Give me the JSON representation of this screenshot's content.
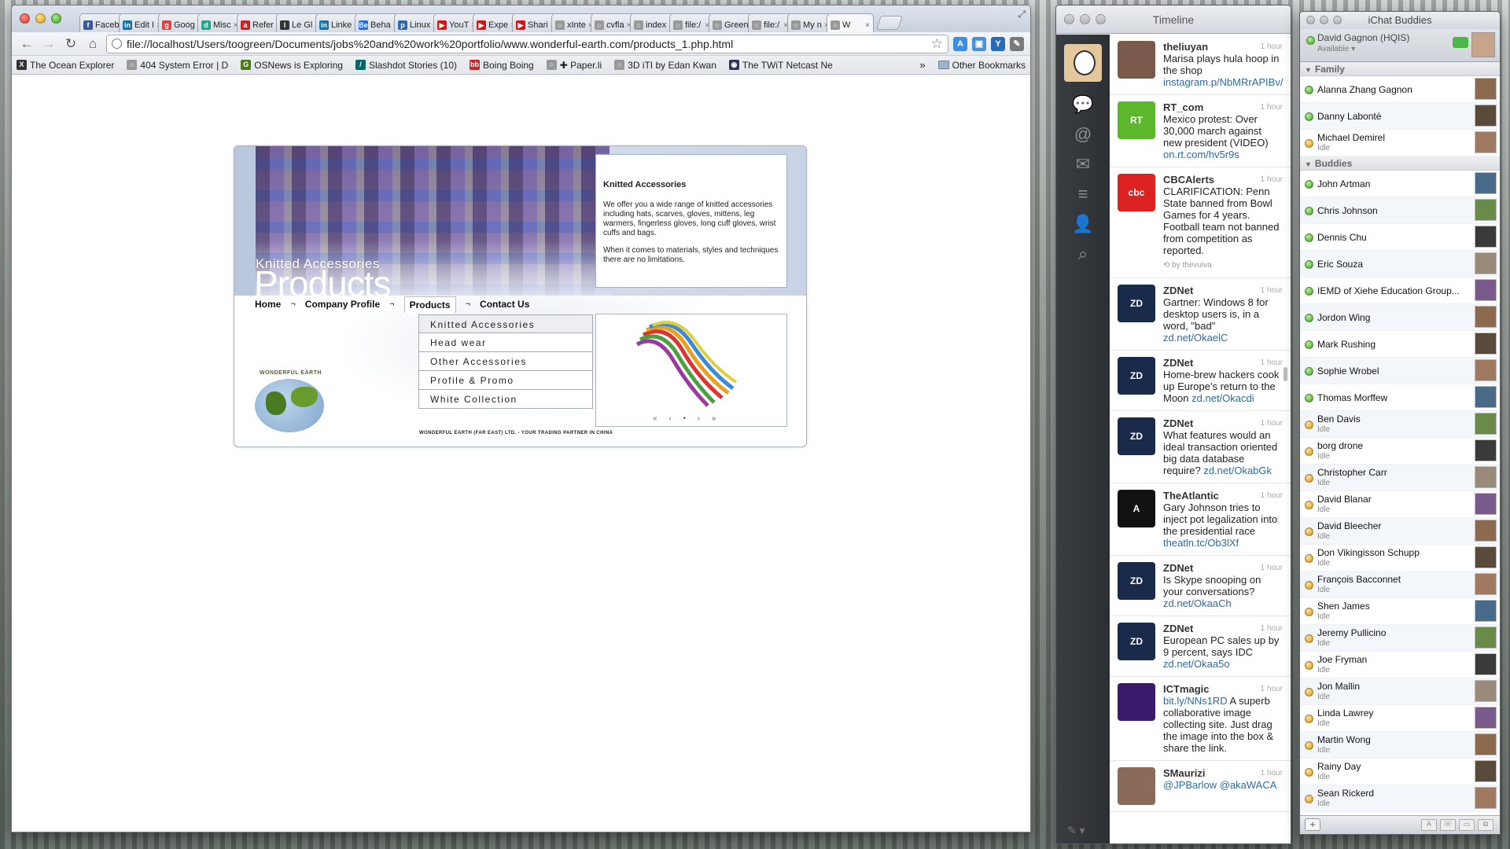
{
  "browser": {
    "tabs": [
      {
        "label": "Faceb",
        "icon": "f",
        "color": "#3b5998"
      },
      {
        "label": "Edit I",
        "icon": "in",
        "color": "#0e76a8"
      },
      {
        "label": "Goog",
        "icon": "g",
        "color": "#d44"
      },
      {
        "label": "Misc",
        "icon": "d",
        "color": "#2a8"
      },
      {
        "label": "Refer",
        "icon": "a",
        "color": "#c22"
      },
      {
        "label": "Le Gl",
        "icon": "l",
        "color": "#333"
      },
      {
        "label": "Linke",
        "icon": "in",
        "color": "#0e76a8"
      },
      {
        "label": "Beha",
        "icon": "Be",
        "color": "#1769ff"
      },
      {
        "label": "Linux",
        "icon": "p",
        "color": "#2a6ab0"
      },
      {
        "label": "YouT",
        "icon": "▶",
        "color": "#d11"
      },
      {
        "label": "Expe",
        "icon": "▶",
        "color": "#d11"
      },
      {
        "label": "Shari",
        "icon": "▶",
        "color": "#d11"
      },
      {
        "label": "xInte",
        "icon": "○",
        "color": "#999"
      },
      {
        "label": "cvfla",
        "icon": "○",
        "color": "#999"
      },
      {
        "label": "index",
        "icon": "○",
        "color": "#999"
      },
      {
        "label": "file:/",
        "icon": "○",
        "color": "#999"
      },
      {
        "label": "Green",
        "icon": "○",
        "color": "#999"
      },
      {
        "label": "file:/",
        "icon": "○",
        "color": "#999"
      },
      {
        "label": "My n",
        "icon": "○",
        "color": "#999"
      },
      {
        "label": "W",
        "icon": "○",
        "color": "#999",
        "active": true
      }
    ],
    "url": "file://localhost/Users/toogreen/Documents/jobs%20and%20work%20portfolio/www.wonderful-earth.com/products_1.php.html",
    "bookmarks": [
      {
        "label": "The Ocean Explorer",
        "icon": "X",
        "color": "#333"
      },
      {
        "label": "404 System Error | D",
        "icon": "○",
        "color": "#999"
      },
      {
        "label": "OSNews is Exploring",
        "icon": "G",
        "color": "#4a7a1a"
      },
      {
        "label": "Slashdot Stories (10)",
        "icon": "/",
        "color": "#006666"
      },
      {
        "label": "Boing Boing",
        "icon": "bb",
        "color": "#c22"
      },
      {
        "label": "✚ Paper.li",
        "icon": "○",
        "color": "#999"
      },
      {
        "label": "3D iTI by Edan Kwan",
        "icon": "○",
        "color": "#999"
      },
      {
        "label": "The TWiT Netcast Ne",
        "icon": "◉",
        "color": "#335"
      }
    ],
    "bookmarks_overflow": "»",
    "other_bookmarks": "Other Bookmarks"
  },
  "site": {
    "banner_subtitle": "Knitted Accessories",
    "banner_title": "Products",
    "info_heading": "Knitted Accessories",
    "info_p1": "We offer you a wide range of knitted accessories including hats, scarves, gloves, mittens, leg warmers, fingerless gloves, long cuff gloves, wrist cuffs and bags.",
    "info_p2": "When it comes to materials, styles and techniques there are no limitations.",
    "nav": [
      "Home",
      "Company Profile",
      "Products",
      "Contact Us"
    ],
    "nav_sep": "¬",
    "submenu": [
      "Knitted Accessories",
      "Head wear",
      "Other Accessories",
      "Profile & Promo",
      "White Collection"
    ],
    "pager": "« ‹ • › »",
    "logo_text": "WONDERFUL EARTH",
    "footer": "WONDERFUL EARTH (FAR EAST) LTD. - YOUR TRADING PARTNER IN CHINA"
  },
  "twitter": {
    "title": "Timeline",
    "tweets": [
      {
        "user": "theliuyan",
        "time": "1 hour",
        "text": "Marisa plays hula hoop in the shop",
        "link": "instagram.p/NbMRrAPIBv/",
        "color": "#7a5a4a",
        "label": ""
      },
      {
        "user": "RT_com",
        "time": "1 hour",
        "text": "Mexico protest: Over 30,000 march against new president (VIDEO)",
        "link": "on.rt.com/hv5r9s",
        "color": "#5cb82a",
        "label": "RT"
      },
      {
        "user": "CBCAlerts",
        "time": "1 hour",
        "text": "CLARIFICATION: Penn State banned from Bowl Games for 4 years. Football team not banned from competition as reported.",
        "link": "",
        "color": "#d22",
        "label": "cbc",
        "retweet": "by thevuiva"
      },
      {
        "user": "ZDNet",
        "time": "1 hour",
        "text": "Gartner: Windows 8 for desktop users is, in a word, \"bad\"",
        "link": "zd.net/OkaelC",
        "color": "#1a2a4a",
        "label": "ZD"
      },
      {
        "user": "ZDNet",
        "time": "1 hour",
        "text": "Home-brew hackers cook up Europe's return to the Moon",
        "link": "zd.net/Okacdi",
        "color": "#1a2a4a",
        "label": "ZD"
      },
      {
        "user": "ZDNet",
        "time": "1 hour",
        "text": "What features would an ideal transaction oriented big data database require?",
        "link": "zd.net/OkabGk",
        "color": "#1a2a4a",
        "label": "ZD"
      },
      {
        "user": "TheAtlantic",
        "time": "1 hour",
        "text": "Gary Johnson tries to inject pot legalization into the presidential race",
        "link": "theatln.tc/Ob3lXf",
        "color": "#111",
        "label": "A"
      },
      {
        "user": "ZDNet",
        "time": "1 hour",
        "text": "Is Skype snooping on your conversations?",
        "link": "zd.net/OkaaCh",
        "color": "#1a2a4a",
        "label": "ZD"
      },
      {
        "user": "ZDNet",
        "time": "1 hour",
        "text": "European PC sales up by 9 percent, says IDC",
        "link": "zd.net/Okaa5o",
        "color": "#1a2a4a",
        "label": "ZD"
      },
      {
        "user": "ICTmagic",
        "time": "1 hour",
        "text": "A superb collaborative image collecting site. Just drag the image into the box & share the link.",
        "link": "bit.ly/NNs1RD",
        "color": "#3a1a6a",
        "label": "",
        "link_first": true
      },
      {
        "user": "SMaurizi",
        "time": "1 hour",
        "text": "",
        "link": "@JPBarlow @akaWACA",
        "color": "#8a6a5a",
        "label": ""
      }
    ]
  },
  "ichat": {
    "title": "iChat Buddies",
    "me_name": "David Gagnon (HQIS)",
    "me_status": "Available ▾",
    "groups": [
      {
        "name": "Family",
        "buddies": [
          {
            "name": "Alanna Zhang Gagnon",
            "status": "green"
          },
          {
            "name": "Danny Labonté",
            "status": "green"
          },
          {
            "name": "Michael Demirel",
            "status": "amber",
            "sub": "Idle"
          }
        ]
      },
      {
        "name": "Buddies",
        "buddies": [
          {
            "name": "John Artman",
            "status": "green"
          },
          {
            "name": "Chris Johnson",
            "status": "green"
          },
          {
            "name": "Dennis Chu",
            "status": "green"
          },
          {
            "name": "Eric Souza",
            "status": "green"
          },
          {
            "name": "IEMD of Xiehe Education Group...",
            "status": "green"
          },
          {
            "name": "Jordon Wing",
            "status": "green"
          },
          {
            "name": "Mark Rushing",
            "status": "green"
          },
          {
            "name": "Sophie Wrobel",
            "status": "green"
          },
          {
            "name": "Thomas Morffew",
            "status": "green"
          },
          {
            "name": "Ben Davis",
            "status": "amber",
            "sub": "Idle"
          },
          {
            "name": "borg drone",
            "status": "amber",
            "sub": "Idle"
          },
          {
            "name": "Christopher Carr",
            "status": "amber",
            "sub": "Idle"
          },
          {
            "name": "David Blanar",
            "status": "amber",
            "sub": "Idle"
          },
          {
            "name": "David Bleecher",
            "status": "amber",
            "sub": "Idle"
          },
          {
            "name": "Don Vikingisson Schupp",
            "status": "amber",
            "sub": "Idle"
          },
          {
            "name": "François Bacconnet",
            "status": "amber",
            "sub": "Idle"
          },
          {
            "name": "Shen James",
            "status": "amber",
            "sub": "Idle"
          },
          {
            "name": "Jeremy Pullicino",
            "status": "amber",
            "sub": "Idle"
          },
          {
            "name": "Joe Fryman",
            "status": "amber",
            "sub": "Idle"
          },
          {
            "name": "Jon Mallin",
            "status": "amber",
            "sub": "Idle"
          },
          {
            "name": "Linda Lawrey",
            "status": "amber",
            "sub": "Idle"
          },
          {
            "name": "Martin Wong",
            "status": "amber",
            "sub": "Idle"
          },
          {
            "name": "Rainy Day",
            "status": "amber",
            "sub": "Idle"
          },
          {
            "name": "Sean Rickerd",
            "status": "amber",
            "sub": "Idle"
          }
        ]
      }
    ]
  }
}
